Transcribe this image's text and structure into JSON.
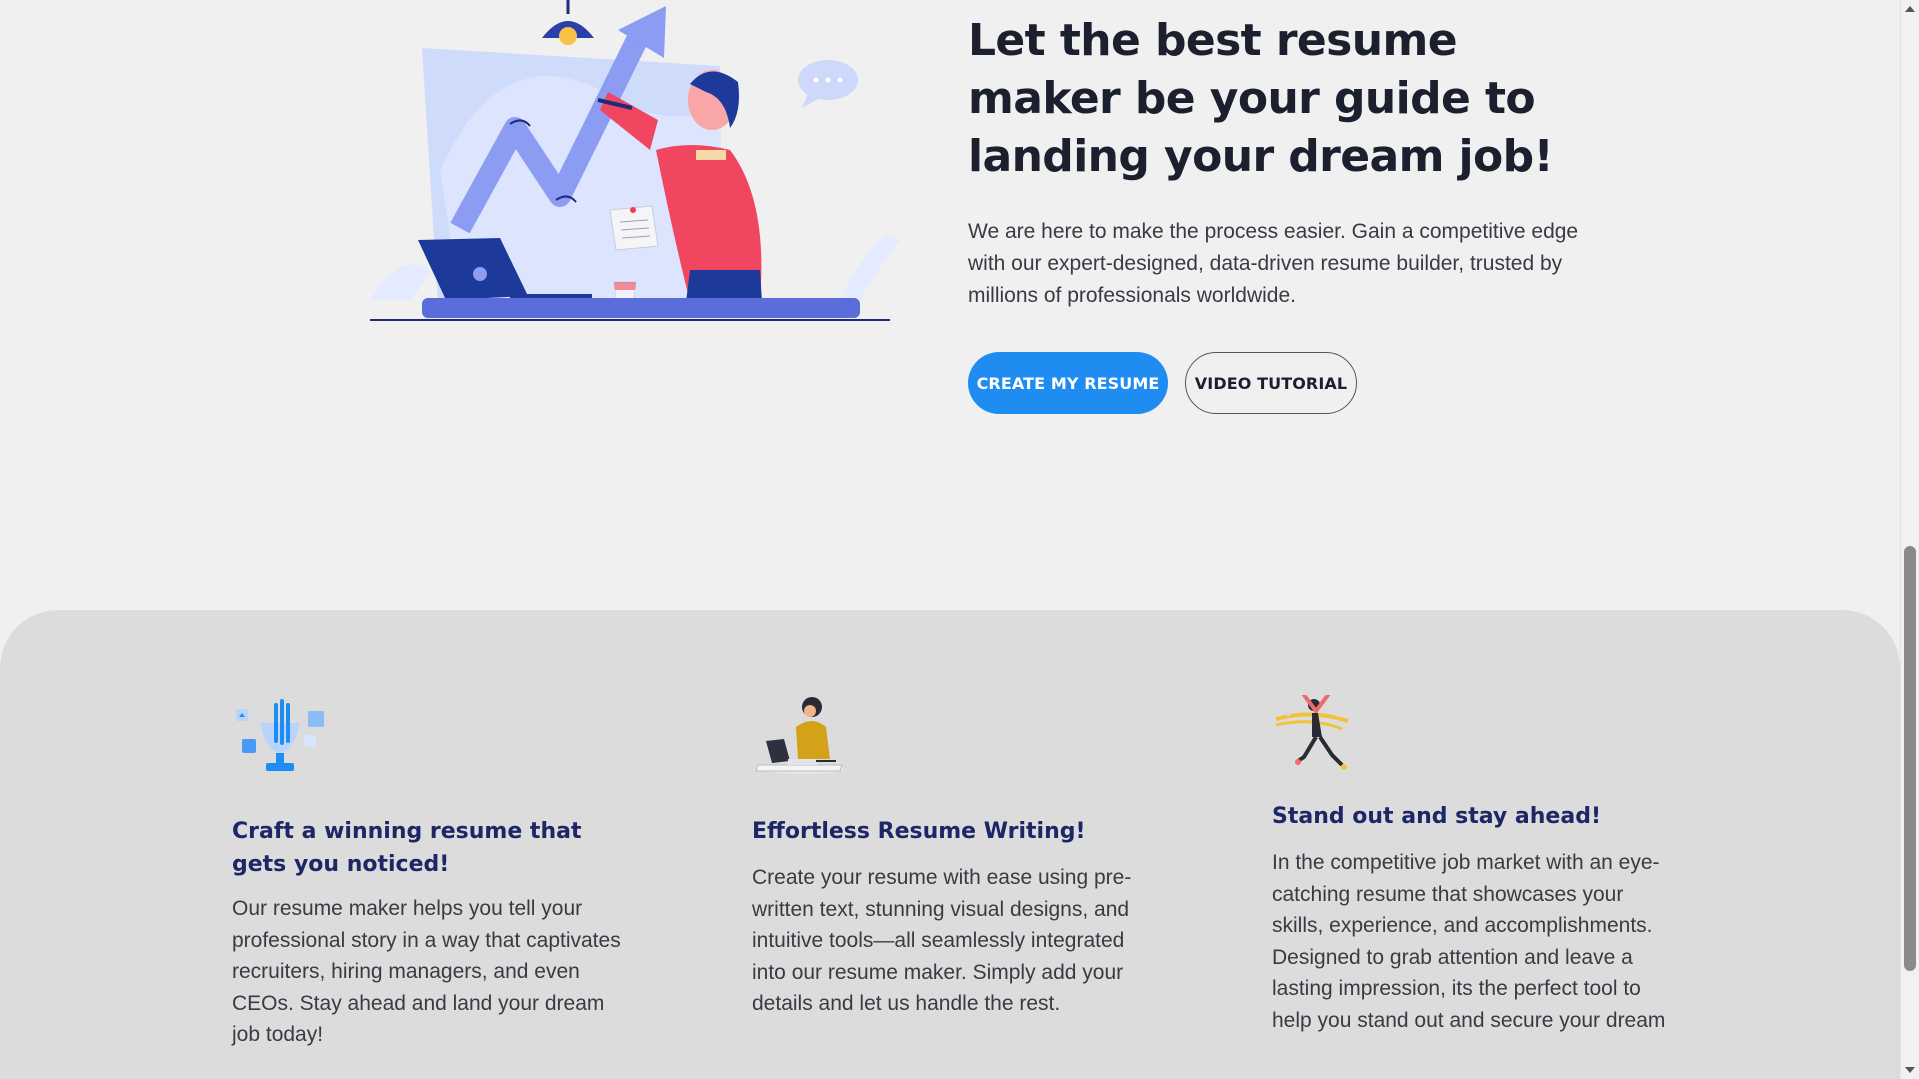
{
  "hero": {
    "title": "Let the best resume maker be your guide to landing your dream job!",
    "description": "We are here to make the process easier. Gain a competitive edge with our expert-designed, data-driven resume builder, trusted by millions of professionals worldwide.",
    "primary_button": "CREATE MY RESUME",
    "secondary_button": "VIDEO TUTORIAL"
  },
  "features": [
    {
      "icon": "trophy-icon",
      "title": "Craft a winning resume that gets you noticed!",
      "text": "Our resume maker helps you tell your professional story in a way that captivates recruiters, hiring managers, and even CEOs. Stay ahead and land your dream job today!"
    },
    {
      "icon": "person-typing-icon",
      "title": "Effortless Resume Writing!",
      "text": "Create your resume with ease using pre-written text, stunning visual designs, and intuitive tools—all seamlessly integrated into our resume maker. Simply add your details and let us handle the rest."
    },
    {
      "icon": "runner-finish-line-icon",
      "title": "Stand out and stay ahead!",
      "text": "In the competitive job market with an eye-catching resume that showcases your skills, experience, and accomplishments. Designed to grab attention and leave a lasting impression, its the perfect tool to help you stand out and secure your dream"
    }
  ],
  "colors": {
    "page_background": "#f0f0f0",
    "features_background": "#dcdcdc",
    "primary": "#1e8cf0",
    "heading_dark": "#1b1f2e",
    "feature_title": "#1d2766"
  }
}
